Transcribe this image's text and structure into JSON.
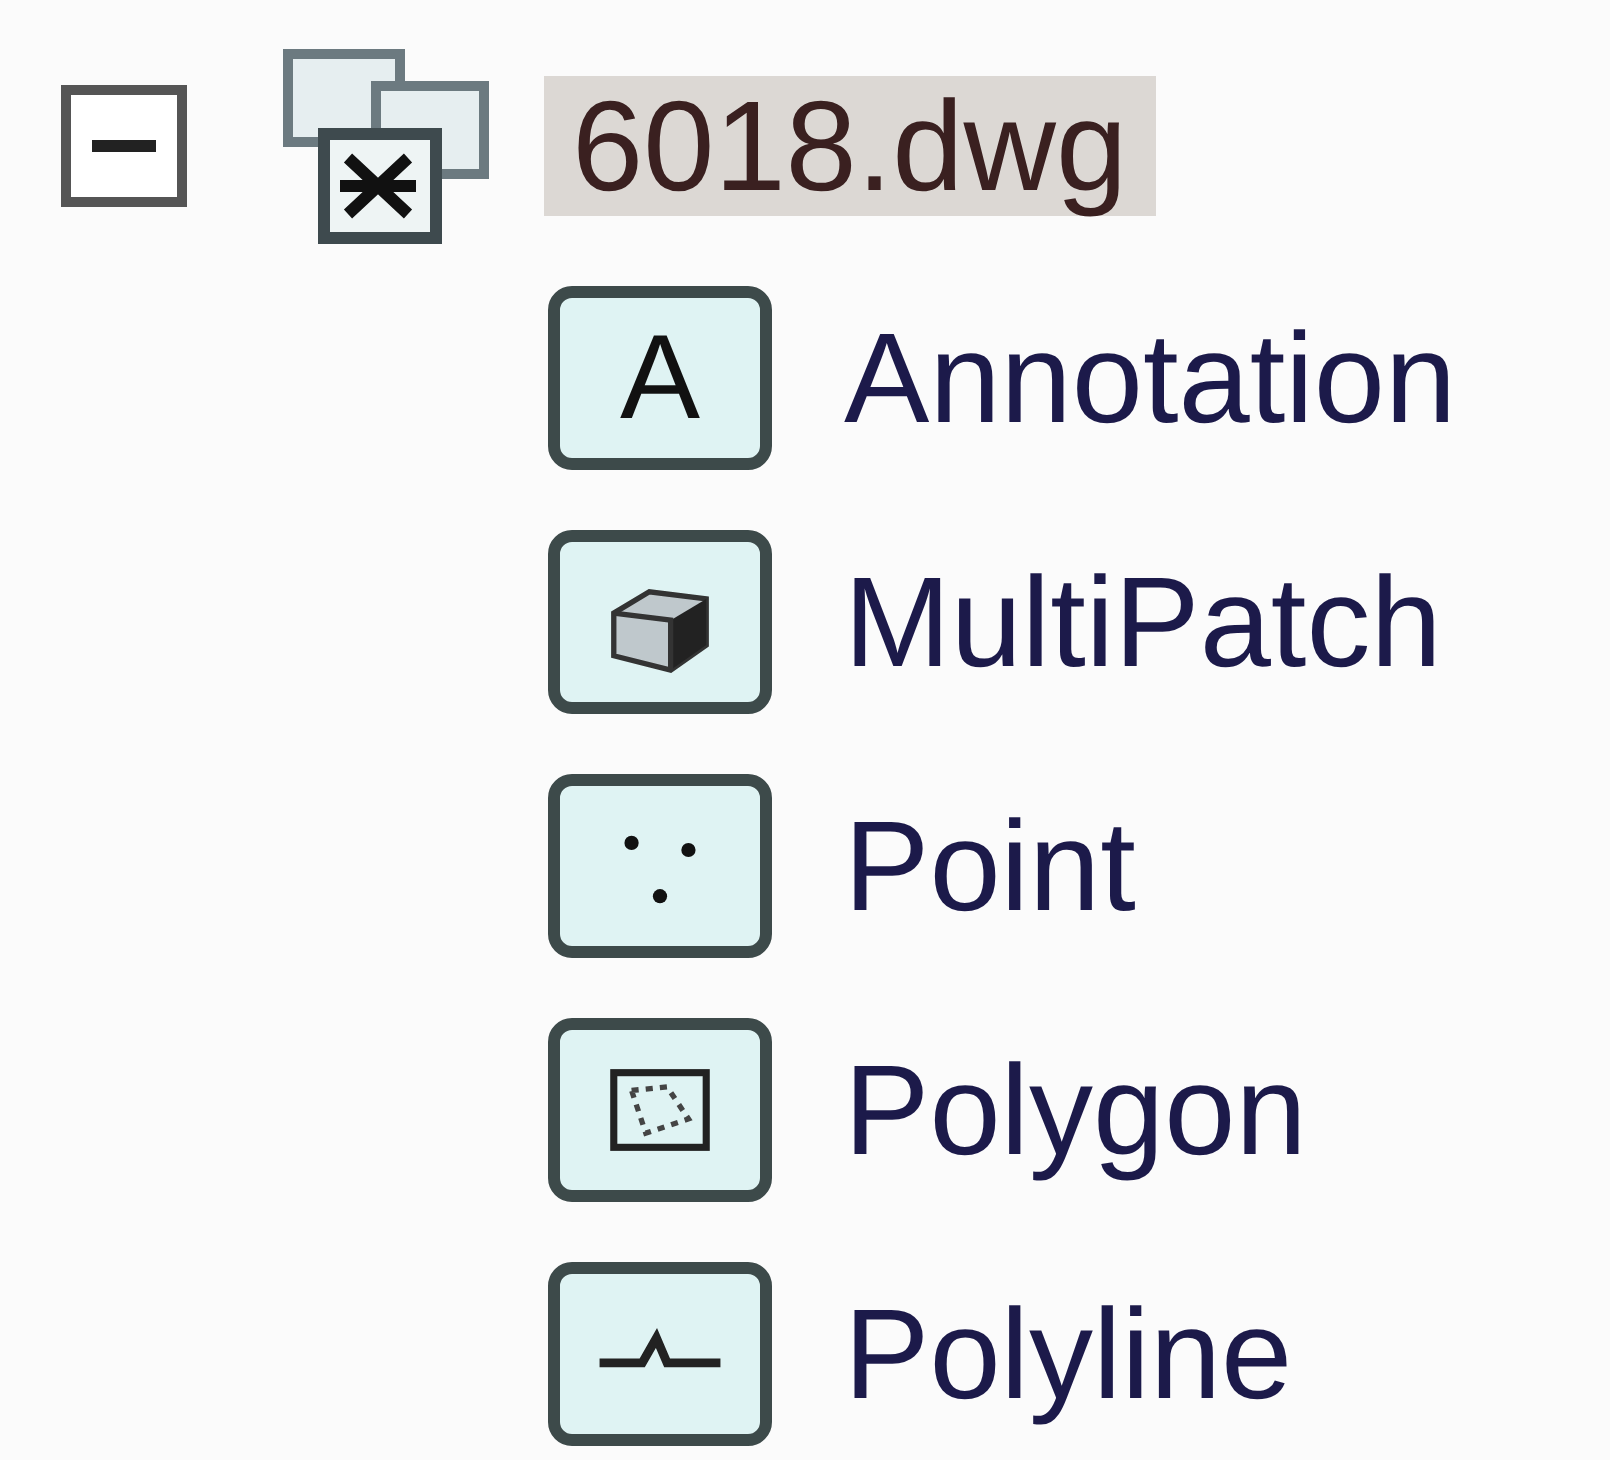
{
  "tree": {
    "label": "6018.dwg",
    "expanded": true,
    "selected": true,
    "children": [
      {
        "label": "Annotation",
        "kind": "annotation",
        "icon_text": "A"
      },
      {
        "label": "MultiPatch",
        "kind": "multipatch"
      },
      {
        "label": "Point",
        "kind": "point"
      },
      {
        "label": "Polygon",
        "kind": "polygon"
      },
      {
        "label": "Polyline",
        "kind": "polyline"
      }
    ]
  }
}
